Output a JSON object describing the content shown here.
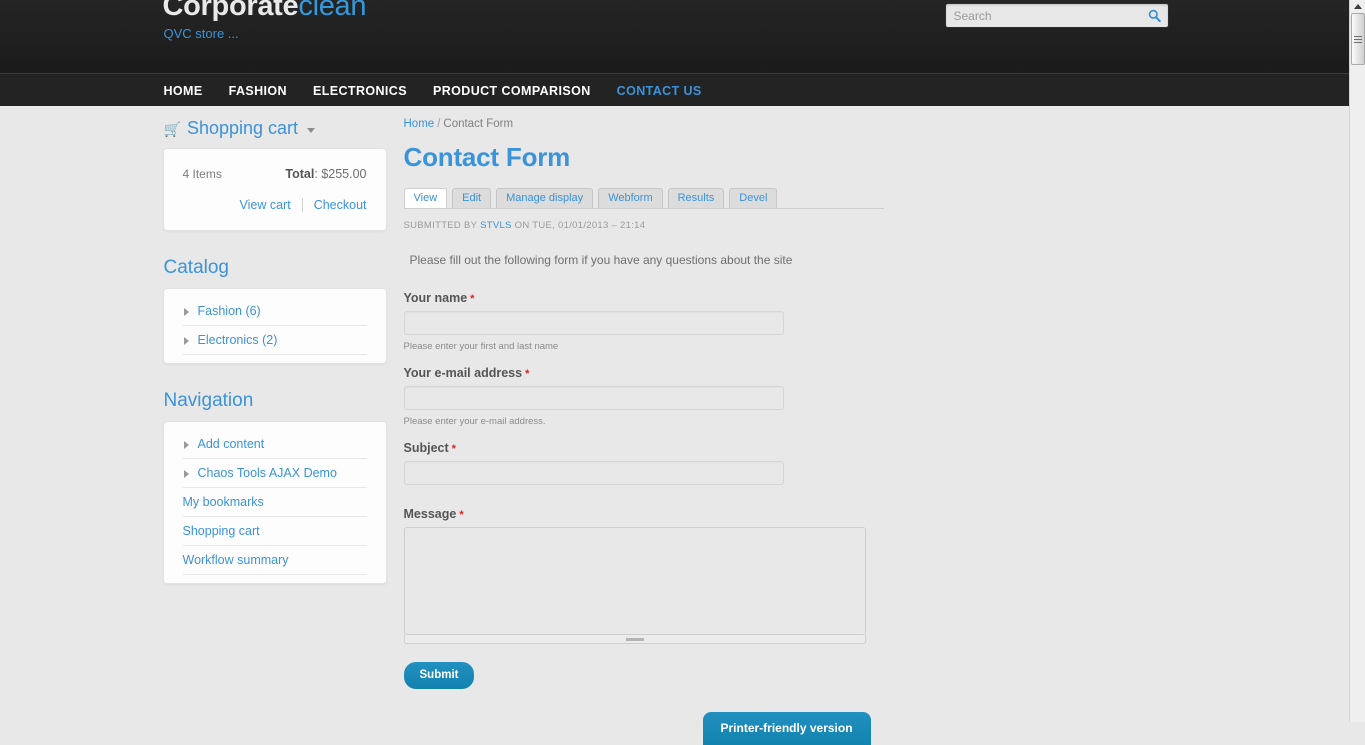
{
  "header": {
    "site_name_bold": "Corporate",
    "site_name_accent": "clean",
    "slogan": "QVC store ...",
    "search_placeholder": "Search",
    "search_value": "",
    "search_icon": "search-icon"
  },
  "nav": {
    "items": [
      {
        "label": "HOME",
        "active": false
      },
      {
        "label": "FASHION",
        "active": false
      },
      {
        "label": "ELECTRONICS",
        "active": false
      },
      {
        "label": "PRODUCT COMPARISON",
        "active": false
      },
      {
        "label": "CONTACT US",
        "active": true
      }
    ]
  },
  "sidebar": {
    "cart": {
      "title": "Shopping cart",
      "icon": "shopping-cart-icon",
      "caret": "chevron-down-icon",
      "items_count": "4 Items",
      "total_label": "Total",
      "total_value": "$255.00",
      "view_cart": "View cart",
      "checkout": "Checkout"
    },
    "catalog": {
      "title": "Catalog",
      "items": [
        {
          "label": "Fashion (6)",
          "expandable": true
        },
        {
          "label": "Electronics (2)",
          "expandable": true
        }
      ]
    },
    "navigation": {
      "title": "Navigation",
      "items": [
        {
          "label": "Add content",
          "expandable": true
        },
        {
          "label": "Chaos Tools AJAX Demo",
          "expandable": true
        },
        {
          "label": "My bookmarks",
          "expandable": false
        },
        {
          "label": "Shopping cart",
          "expandable": false
        },
        {
          "label": "Workflow summary",
          "expandable": false
        }
      ]
    }
  },
  "main": {
    "breadcrumb": {
      "home": "Home",
      "separator": "/",
      "current": "Contact Form"
    },
    "title": "Contact Form",
    "tabs": [
      {
        "label": "View",
        "active": true
      },
      {
        "label": "Edit",
        "active": false
      },
      {
        "label": "Manage display",
        "active": false
      },
      {
        "label": "Webform",
        "active": false
      },
      {
        "label": "Results",
        "active": false
      },
      {
        "label": "Devel",
        "active": false
      }
    ],
    "submitted": {
      "prefix": "SUBMITTED BY",
      "user": "STVLS",
      "suffix": "ON TUE, 01/01/2013 – 21:14"
    },
    "form": {
      "intro": "Please fill out the following form if you have any questions about the site",
      "required_marker": "*",
      "fields": [
        {
          "label": "Your name",
          "value": "",
          "description": "Please enter your first and last name",
          "required": true
        },
        {
          "label": "Your e-mail address",
          "value": "",
          "description": "Please enter your e-mail address.",
          "required": true
        },
        {
          "label": "Subject",
          "value": "",
          "description": "",
          "required": true
        },
        {
          "label": "Message",
          "value": "",
          "description": "",
          "required": true
        }
      ],
      "submit_label": "Submit"
    },
    "printer_friendly_label": "Printer-friendly version"
  },
  "colors": {
    "accent_blue": "#3b93d9",
    "button_blue": "#1282af",
    "required_red": "#dd2222",
    "page_bg": "#e8e8e8",
    "header_bg": "#212121"
  }
}
